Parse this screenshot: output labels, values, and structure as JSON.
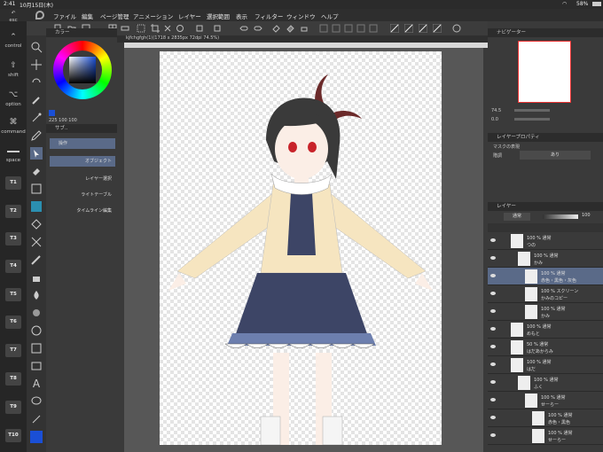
{
  "status": {
    "time": "2:41",
    "date": "10月15日(木)",
    "battery": "58%"
  },
  "menu": [
    "ファイル",
    "編集",
    "ページ管理",
    "アニメーション",
    "レイヤー",
    "選択範囲",
    "表示",
    "フィルター",
    "ウィンドウ",
    "ヘルプ"
  ],
  "modifiers": {
    "esc": "esc",
    "control": "control",
    "shift": "shift",
    "option": "option",
    "command": "command",
    "space": "space"
  },
  "fkeys": [
    "T1",
    "T2",
    "T3",
    "T4",
    "T5",
    "T6",
    "T7",
    "T8",
    "T9",
    "T10"
  ],
  "canvas_tab": "kjfchgfgh(1)(1718 x 2835px 72dpi 74.5%)",
  "color_panel": {
    "title": "カラー",
    "values": "225 100 100",
    "accent": "#1a4fd6"
  },
  "sub_tool": {
    "title": "サブ..",
    "rows": [
      "操作",
      "オブジェクト",
      "レイヤー選択",
      "ライトテーブル",
      "タイムライン編集"
    ]
  },
  "navigator": {
    "title": "ナビゲーター",
    "zoom": "74.5",
    "angle": "0.0"
  },
  "layer_property": {
    "title": "レイヤープロパティ",
    "mask_label": "マスクの表現",
    "display_label": "階調",
    "display_value": "あり"
  },
  "layer_panel": {
    "title": "レイヤー",
    "blend": "通常",
    "opacity": "100",
    "layers": [
      {
        "line1": "100 % 通常",
        "line2": "つの",
        "indent": 0
      },
      {
        "line1": "100 % 通常",
        "line2": "かみ",
        "indent": 1
      },
      {
        "line1": "100 % 通常",
        "line2": "赤色・黒色・灰色",
        "indent": 2,
        "selected": true
      },
      {
        "line1": "100 % スクリーン",
        "line2": "かみのコピー",
        "indent": 2
      },
      {
        "line1": "100 % 通常",
        "line2": "かみ",
        "indent": 2
      },
      {
        "line1": "100 % 通常",
        "line2": "めもと",
        "indent": 0
      },
      {
        "line1": "50 % 通常",
        "line2": "はだあからみ",
        "indent": 0
      },
      {
        "line1": "100 % 通常",
        "line2": "はだ",
        "indent": 0
      },
      {
        "line1": "100 % 通常",
        "line2": "ふく",
        "indent": 1
      },
      {
        "line1": "100 % 通常",
        "line2": "せーらー",
        "indent": 2
      },
      {
        "line1": "100 % 通常",
        "line2": "赤色・黒色",
        "indent": 3
      },
      {
        "line1": "100 % 通常",
        "line2": "せーらー",
        "indent": 3
      }
    ]
  }
}
